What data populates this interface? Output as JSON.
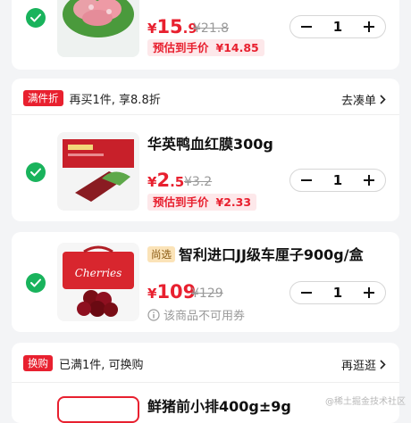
{
  "items": [
    {
      "checked": true,
      "price_yen": "¥",
      "price_int": "15",
      "price_dec": ".9",
      "orig_price": "¥21.8",
      "estimate_label": "预估到手价",
      "estimate_value": "¥14.85",
      "quantity": "1"
    },
    {
      "checked": true,
      "name": "华英鸭血红膜300g",
      "price_yen": "¥",
      "price_int": "2",
      "price_dec": ".5",
      "orig_price": "¥3.2",
      "estimate_label": "预估到手价",
      "estimate_value": "¥2.33",
      "quantity": "1"
    },
    {
      "checked": true,
      "badge": "尚选",
      "name": "智利进口JJ级车厘子900g/盒",
      "thumb_text": "Cherries",
      "price_yen": "¥",
      "price_int": "109",
      "orig_price": "¥129",
      "note": "该商品不可用券",
      "quantity": "1"
    },
    {
      "name": "鲜猪前小排400g±9g"
    }
  ],
  "promos": [
    {
      "tag": "满件折",
      "text": "再买1件, 享8.8折",
      "link": "去凑单"
    },
    {
      "tag": "换购",
      "text": "已满1件, 可换购",
      "link": "再逛逛"
    }
  ],
  "watermark": "@稀土掘金技术社区",
  "colors": {
    "accent_red": "#e8202f",
    "check_green": "#19b35c",
    "estimate_bg": "#fde8ea"
  }
}
